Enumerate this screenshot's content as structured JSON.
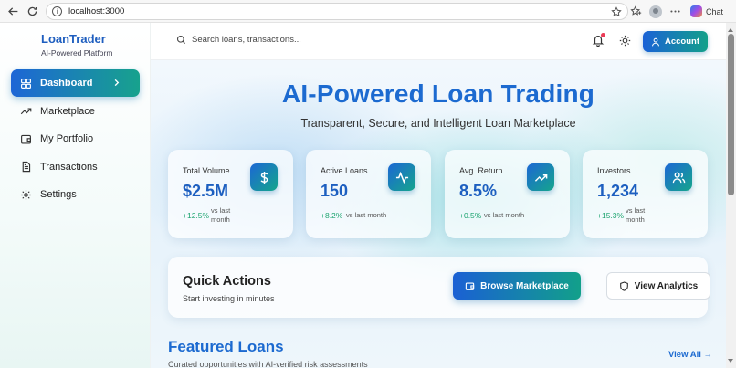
{
  "browser": {
    "url": "localhost:3000",
    "chat_label": "Chat"
  },
  "sidebar": {
    "brand_name": "LoanTrader",
    "brand_tagline": "AI-Powered Platform",
    "items": [
      {
        "label": "Dashboard",
        "icon": "grid-icon",
        "active": true
      },
      {
        "label": "Marketplace",
        "icon": "trending-up-icon"
      },
      {
        "label": "My Portfolio",
        "icon": "wallet-icon"
      },
      {
        "label": "Transactions",
        "icon": "document-icon"
      },
      {
        "label": "Settings",
        "icon": "gear-icon"
      }
    ]
  },
  "topbar": {
    "search_placeholder": "Search loans, transactions...",
    "account_label": "Account"
  },
  "hero": {
    "title": "AI-Powered Loan Trading",
    "subtitle": "Transparent, Secure, and Intelligent Loan Marketplace"
  },
  "stats": [
    {
      "label": "Total Volume",
      "value": "$2.5M",
      "change": "+12.5%",
      "vs": "vs last month",
      "icon": "dollar-icon"
    },
    {
      "label": "Active Loans",
      "value": "150",
      "change": "+8.2%",
      "vs": "vs last month",
      "icon": "activity-icon"
    },
    {
      "label": "Avg. Return",
      "value": "8.5%",
      "change": "+0.5%",
      "vs": "vs last month",
      "icon": "trending-up-icon"
    },
    {
      "label": "Investors",
      "value": "1,234",
      "change": "+15.3%",
      "vs": "vs last month",
      "icon": "users-icon"
    }
  ],
  "quick_actions": {
    "title": "Quick Actions",
    "subtitle": "Start investing in minutes",
    "browse_label": "Browse Marketplace",
    "analytics_label": "View Analytics"
  },
  "featured": {
    "title": "Featured Loans",
    "subtitle": "Curated opportunities with AI-verified risk assessments",
    "view_all": "View All →"
  },
  "colors": {
    "primary_blue": "#1c6ad0",
    "accent_teal": "#13a08a",
    "positive_green": "#1aa36e",
    "notification_red": "#ec3b57"
  }
}
